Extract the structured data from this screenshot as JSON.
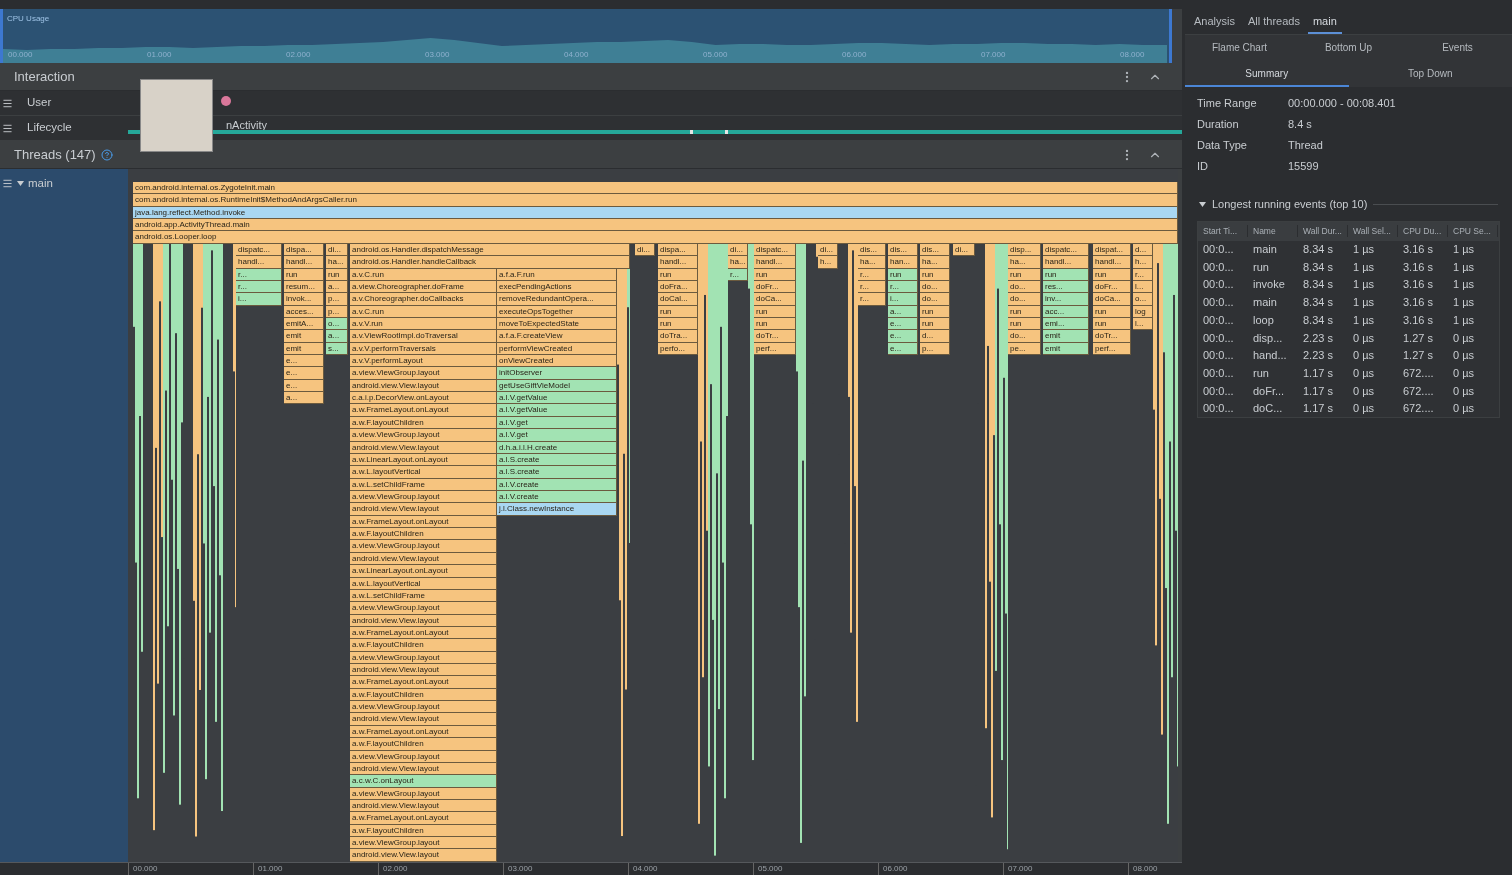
{
  "cpu_usage": {
    "title": "CPU Usage",
    "time_ticks": [
      "00.000",
      "01.000",
      "02.000",
      "03.000",
      "04.000",
      "05.000",
      "06.000",
      "07.000",
      "08.000"
    ]
  },
  "interaction": {
    "title": "Interaction",
    "rows": [
      {
        "label": "User",
        "kind": "user"
      },
      {
        "label": "Lifecycle",
        "kind": "lifecycle",
        "event": "nActivity"
      }
    ]
  },
  "threads": {
    "title": "Threads (147)",
    "thread": {
      "name": "main",
      "expanded": true
    }
  },
  "flame_chart": {
    "root_frames": [
      {
        "label": "com.android.internal.os.ZygoteInit.main",
        "kind": "system"
      },
      {
        "label": "com.android.internal.os.RuntimeInit$MethodAndArgsCaller.run",
        "kind": "system"
      },
      {
        "label": "java.lang.reflect.Method.invoke",
        "kind": "third_party"
      },
      {
        "label": "android.app.ActivityThread.main",
        "kind": "system"
      },
      {
        "label": "android.os.Looper.loop",
        "kind": "system"
      }
    ],
    "stacks": [
      {
        "frames": [
          {
            "label": "dispatc...",
            "kind": "system"
          },
          {
            "label": "handl...",
            "kind": "system"
          },
          {
            "label": "r...",
            "kind": "app"
          },
          {
            "label": "r...",
            "kind": "app"
          },
          {
            "label": "i...",
            "kind": "app"
          }
        ]
      },
      {
        "frames": [
          {
            "label": "dispa...",
            "kind": "system"
          },
          {
            "label": "handl...",
            "kind": "system"
          },
          {
            "label": "run",
            "kind": "system"
          },
          {
            "label": "resum...",
            "kind": "system"
          },
          {
            "label": "invok...",
            "kind": "system"
          },
          {
            "label": "acces...",
            "kind": "system"
          },
          {
            "label": "emitA...",
            "kind": "system"
          },
          {
            "label": "emit",
            "kind": "system"
          },
          {
            "label": "emit",
            "kind": "system"
          },
          {
            "label": "e...",
            "kind": "system"
          },
          {
            "label": "e...",
            "kind": "system"
          },
          {
            "label": "e...",
            "kind": "system"
          },
          {
            "label": "a...",
            "kind": "system"
          }
        ]
      },
      {
        "frames": [
          {
            "label": "di...",
            "kind": "system"
          },
          {
            "label": "ha...",
            "kind": "system"
          },
          {
            "label": "run",
            "kind": "system"
          },
          {
            "label": "a...",
            "kind": "system"
          },
          {
            "label": "p...",
            "kind": "system"
          },
          {
            "label": "p...",
            "kind": "system"
          },
          {
            "label": "o...",
            "kind": "app"
          },
          {
            "label": "a...",
            "kind": "app"
          },
          {
            "label": "s...",
            "kind": "app"
          }
        ]
      },
      {
        "frames": [
          {
            "label": "android.os.Handler.dispatchMessage",
            "kind": "system"
          },
          {
            "label": "android.os.Handler.handleCallback",
            "kind": "system"
          }
        ],
        "branches": [
          [
            {
              "label": "a.v.C.run",
              "kind": "system"
            },
            {
              "label": "a.view.Choreographer.doFrame",
              "kind": "system"
            },
            {
              "label": "a.v.Choreographer.doCallbacks",
              "kind": "system"
            },
            {
              "label": "a.v.C.run",
              "kind": "system"
            },
            {
              "label": "a.v.V.run",
              "kind": "system"
            },
            {
              "label": "a.v.ViewRootImpl.doTraversal",
              "kind": "system"
            },
            {
              "label": "a.v.V.performTraversals",
              "kind": "system"
            },
            {
              "label": "a.v.V.performLayout",
              "kind": "system"
            },
            {
              "label": "a.view.ViewGroup.layout",
              "kind": "system"
            },
            {
              "label": "android.view.View.layout",
              "kind": "system"
            },
            {
              "label": "c.a.i.p.DecorView.onLayout",
              "kind": "system"
            },
            {
              "label": "a.w.FrameLayout.onLayout",
              "kind": "system"
            },
            {
              "label": "a.w.F.layoutChildren",
              "kind": "system"
            },
            {
              "label": "a.view.ViewGroup.layout",
              "kind": "system"
            },
            {
              "label": "android.view.View.layout",
              "kind": "system"
            },
            {
              "label": "a.w.LinearLayout.onLayout",
              "kind": "system"
            },
            {
              "label": "a.w.L.layoutVertical",
              "kind": "system"
            },
            {
              "label": "a.w.L.setChildFrame",
              "kind": "system"
            },
            {
              "label": "a.view.ViewGroup.layout",
              "kind": "system"
            },
            {
              "label": "android.view.View.layout",
              "kind": "system"
            },
            {
              "label": "a.w.FrameLayout.onLayout",
              "kind": "system"
            },
            {
              "label": "a.w.F.layoutChildren",
              "kind": "system"
            },
            {
              "label": "a.view.ViewGroup.layout",
              "kind": "system"
            },
            {
              "label": "android.view.View.layout",
              "kind": "system"
            },
            {
              "label": "a.w.LinearLayout.onLayout",
              "kind": "system"
            },
            {
              "label": "a.w.L.layoutVertical",
              "kind": "system"
            },
            {
              "label": "a.w.L.setChildFrame",
              "kind": "system"
            },
            {
              "label": "a.view.ViewGroup.layout",
              "kind": "system"
            },
            {
              "label": "android.view.View.layout",
              "kind": "system"
            },
            {
              "label": "a.w.FrameLayout.onLayout",
              "kind": "system"
            },
            {
              "label": "a.w.F.layoutChildren",
              "kind": "system"
            },
            {
              "label": "a.view.ViewGroup.layout",
              "kind": "system"
            },
            {
              "label": "android.view.View.layout",
              "kind": "system"
            },
            {
              "label": "a.w.FrameLayout.onLayout",
              "kind": "system"
            },
            {
              "label": "a.w.F.layoutChildren",
              "kind": "system"
            },
            {
              "label": "a.view.ViewGroup.layout",
              "kind": "system"
            },
            {
              "label": "android.view.View.layout",
              "kind": "system"
            },
            {
              "label": "a.w.FrameLayout.onLayout",
              "kind": "system"
            },
            {
              "label": "a.w.F.layoutChildren",
              "kind": "system"
            },
            {
              "label": "a.view.ViewGroup.layout",
              "kind": "system"
            },
            {
              "label": "android.view.View.layout",
              "kind": "system"
            },
            {
              "label": "a.c.w.C.onLayout",
              "kind": "app"
            },
            {
              "label": "a.view.ViewGroup.layout",
              "kind": "system"
            },
            {
              "label": "android.view.View.layout",
              "kind": "system"
            },
            {
              "label": "a.w.FrameLayout.onLayout",
              "kind": "system"
            },
            {
              "label": "a.w.F.layoutChildren",
              "kind": "system"
            },
            {
              "label": "a.view.ViewGroup.layout",
              "kind": "system"
            },
            {
              "label": "android.view.View.layout",
              "kind": "system"
            }
          ],
          [
            {
              "label": "a.f.a.F.run",
              "kind": "system"
            },
            {
              "label": "execPendingActions",
              "kind": "system"
            },
            {
              "label": "removeRedundantOpera...",
              "kind": "system"
            },
            {
              "label": "executeOpsTogether",
              "kind": "system"
            },
            {
              "label": "moveToExpectedState",
              "kind": "system"
            },
            {
              "label": "a.f.a.F.createView",
              "kind": "system"
            },
            {
              "label": "performViewCreated",
              "kind": "system"
            },
            {
              "label": "onViewCreated",
              "kind": "system"
            },
            {
              "label": "initObserver",
              "kind": "app"
            },
            {
              "label": "getUseGiftVieModel",
              "kind": "app"
            },
            {
              "label": "a.l.V.getValue",
              "kind": "app"
            },
            {
              "label": "a.l.V.getValue",
              "kind": "app"
            },
            {
              "label": "a.l.V.get",
              "kind": "app"
            },
            {
              "label": "a.l.V.get",
              "kind": "app"
            },
            {
              "label": "d.h.a.i.l.H.create",
              "kind": "app"
            },
            {
              "label": "a.l.S.create",
              "kind": "app"
            },
            {
              "label": "a.l.S.create",
              "kind": "app"
            },
            {
              "label": "a.l.V.create",
              "kind": "app"
            },
            {
              "label": "a.l.V.create",
              "kind": "app"
            },
            {
              "label": "j.l.Class.newInstance",
              "kind": "third_party"
            }
          ]
        ]
      },
      {
        "frames": [
          {
            "label": "di...",
            "kind": "system"
          }
        ]
      },
      {
        "frames": [
          {
            "label": "dispa...",
            "kind": "system"
          },
          {
            "label": "handl...",
            "kind": "system"
          },
          {
            "label": "run",
            "kind": "system"
          },
          {
            "label": "doFra...",
            "kind": "system"
          },
          {
            "label": "doCal...",
            "kind": "system"
          },
          {
            "label": "run",
            "kind": "system"
          },
          {
            "label": "run",
            "kind": "system"
          },
          {
            "label": "doTra...",
            "kind": "system"
          },
          {
            "label": "perfo...",
            "kind": "system"
          }
        ]
      },
      {
        "frames": [
          {
            "label": "di...",
            "kind": "system"
          },
          {
            "label": "ha...",
            "kind": "system"
          },
          {
            "label": "r...",
            "kind": "app"
          }
        ]
      },
      {
        "frames": [
          {
            "label": "dispatc...",
            "kind": "system"
          },
          {
            "label": "handl...",
            "kind": "system"
          },
          {
            "label": "run",
            "kind": "system"
          },
          {
            "label": "doFr...",
            "kind": "system"
          },
          {
            "label": "doCa...",
            "kind": "system"
          },
          {
            "label": "run",
            "kind": "system"
          },
          {
            "label": "run",
            "kind": "system"
          },
          {
            "label": "doTr...",
            "kind": "system"
          },
          {
            "label": "perf...",
            "kind": "system"
          }
        ]
      },
      {
        "frames": [
          {
            "label": "di...",
            "kind": "system"
          },
          {
            "label": "h...",
            "kind": "system"
          }
        ]
      },
      {
        "frames": [
          {
            "label": "dis...",
            "kind": "system"
          },
          {
            "label": "ha...",
            "kind": "system"
          },
          {
            "label": "r...",
            "kind": "system"
          },
          {
            "label": "r...",
            "kind": "system"
          },
          {
            "label": "r...",
            "kind": "system"
          }
        ]
      },
      {
        "frames": [
          {
            "label": "dis...",
            "kind": "system"
          },
          {
            "label": "han...",
            "kind": "system"
          },
          {
            "label": "run",
            "kind": "app"
          },
          {
            "label": "r...",
            "kind": "app"
          },
          {
            "label": "i...",
            "kind": "app"
          },
          {
            "label": "a...",
            "kind": "app"
          },
          {
            "label": "e...",
            "kind": "app"
          },
          {
            "label": "e...",
            "kind": "app"
          },
          {
            "label": "e...",
            "kind": "app"
          }
        ]
      },
      {
        "frames": [
          {
            "label": "dis...",
            "kind": "system"
          },
          {
            "label": "ha...",
            "kind": "system"
          },
          {
            "label": "run",
            "kind": "system"
          },
          {
            "label": "do...",
            "kind": "system"
          },
          {
            "label": "do...",
            "kind": "system"
          },
          {
            "label": "run",
            "kind": "system"
          },
          {
            "label": "run",
            "kind": "system"
          },
          {
            "label": "d...",
            "kind": "system"
          },
          {
            "label": "p...",
            "kind": "system"
          }
        ]
      },
      {
        "frames": [
          {
            "label": "di...",
            "kind": "system"
          }
        ]
      },
      {
        "frames": [
          {
            "label": "disp...",
            "kind": "system"
          },
          {
            "label": "ha...",
            "kind": "system"
          },
          {
            "label": "run",
            "kind": "system"
          },
          {
            "label": "do...",
            "kind": "system"
          },
          {
            "label": "do...",
            "kind": "system"
          },
          {
            "label": "run",
            "kind": "system"
          },
          {
            "label": "run",
            "kind": "system"
          },
          {
            "label": "do...",
            "kind": "system"
          },
          {
            "label": "pe...",
            "kind": "system"
          }
        ]
      },
      {
        "frames": [
          {
            "label": "dispatc...",
            "kind": "system"
          },
          {
            "label": "handl...",
            "kind": "system"
          },
          {
            "label": "run",
            "kind": "app"
          },
          {
            "label": "res...",
            "kind": "app"
          },
          {
            "label": "inv...",
            "kind": "app"
          },
          {
            "label": "acc...",
            "kind": "app"
          },
          {
            "label": "emi...",
            "kind": "app"
          },
          {
            "label": "emit",
            "kind": "app"
          },
          {
            "label": "emit",
            "kind": "app"
          }
        ]
      },
      {
        "frames": [
          {
            "label": "dispat...",
            "kind": "system"
          },
          {
            "label": "handl...",
            "kind": "system"
          },
          {
            "label": "run",
            "kind": "system"
          },
          {
            "label": "doFr...",
            "kind": "system"
          },
          {
            "label": "doCa...",
            "kind": "system"
          },
          {
            "label": "run",
            "kind": "system"
          },
          {
            "label": "run",
            "kind": "system"
          },
          {
            "label": "doTr...",
            "kind": "system"
          },
          {
            "label": "perf...",
            "kind": "system"
          }
        ]
      },
      {
        "frames": [
          {
            "label": "d...",
            "kind": "system"
          },
          {
            "label": "h...",
            "kind": "system"
          },
          {
            "label": "r...",
            "kind": "system"
          },
          {
            "label": "l...",
            "kind": "system"
          },
          {
            "label": "o...",
            "kind": "system"
          },
          {
            "label": "log",
            "kind": "system"
          },
          {
            "label": "l...",
            "kind": "system"
          }
        ]
      }
    ]
  },
  "time_axis": {
    "ticks": [
      "00.000",
      "01.000",
      "02.000",
      "03.000",
      "04.000",
      "05.000",
      "06.000",
      "07.000",
      "08.000"
    ]
  },
  "analysis_panel": {
    "tabs": [
      {
        "label": "Analysis",
        "selected": false
      },
      {
        "label": "All threads",
        "selected": false
      },
      {
        "label": "main",
        "selected": true
      }
    ],
    "view_tabs": [
      {
        "label": "Flame Chart",
        "selected": false
      },
      {
        "label": "Bottom Up",
        "selected": false
      },
      {
        "label": "Events",
        "selected": false
      },
      {
        "label": "Summary",
        "selected": true
      },
      {
        "label": "Top Down",
        "selected": false
      }
    ],
    "summary": [
      {
        "label": "Time Range",
        "value": "00:00.000 - 00:08.401"
      },
      {
        "label": "Duration",
        "value": "8.4 s"
      },
      {
        "label": "Data Type",
        "value": "Thread"
      },
      {
        "label": "ID",
        "value": "15599"
      }
    ],
    "events_section": {
      "title": "Longest running events (top 10)",
      "expanded": true
    },
    "table": {
      "columns": [
        "Start Ti...",
        "Name",
        "Wall Dur...",
        "Wall Sel...",
        "CPU Du...",
        "CPU Se..."
      ],
      "rows": [
        [
          "00:0...",
          "main",
          "8.34 s",
          "1 µs",
          "3.16 s",
          "1 µs"
        ],
        [
          "00:0...",
          "run",
          "8.34 s",
          "1 µs",
          "3.16 s",
          "1 µs"
        ],
        [
          "00:0...",
          "invoke",
          "8.34 s",
          "1 µs",
          "3.16 s",
          "1 µs"
        ],
        [
          "00:0...",
          "main",
          "8.34 s",
          "1 µs",
          "3.16 s",
          "1 µs"
        ],
        [
          "00:0...",
          "loop",
          "8.34 s",
          "1 µs",
          "3.16 s",
          "1 µs"
        ],
        [
          "00:0...",
          "disp...",
          "2.23 s",
          "0 µs",
          "1.27 s",
          "0 µs"
        ],
        [
          "00:0...",
          "hand...",
          "2.23 s",
          "0 µs",
          "1.27 s",
          "0 µs"
        ],
        [
          "00:0...",
          "run",
          "1.17 s",
          "0 µs",
          "672....",
          "0 µs"
        ],
        [
          "00:0...",
          "doFr...",
          "1.17 s",
          "0 µs",
          "672....",
          "0 µs"
        ],
        [
          "00:0...",
          "doC...",
          "1.17 s",
          "0 µs",
          "672....",
          "0 µs"
        ]
      ]
    }
  }
}
